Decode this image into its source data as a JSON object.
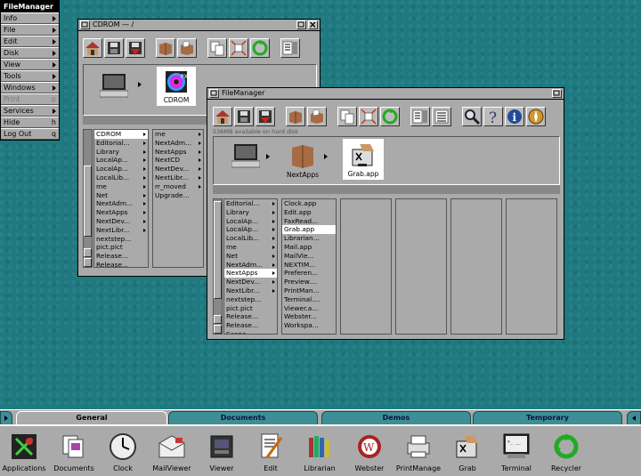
{
  "main_menu": {
    "title": "FileManager",
    "items": [
      {
        "label": "Info",
        "key": "arrow"
      },
      {
        "label": "File",
        "key": "arrow"
      },
      {
        "label": "Edit",
        "key": "arrow"
      },
      {
        "label": "Disk",
        "key": "arrow"
      },
      {
        "label": "View",
        "key": "arrow"
      },
      {
        "label": "Tools",
        "key": "arrow"
      },
      {
        "label": "Windows",
        "key": "arrow"
      },
      {
        "label": "Print",
        "key": "p",
        "disabled": true
      },
      {
        "label": "Services",
        "key": "arrow"
      },
      {
        "label": "Hide",
        "key": "h"
      },
      {
        "label": "Log Out",
        "key": "q"
      }
    ]
  },
  "cdrom_window": {
    "title": "CDROM — /",
    "shelf": {
      "cdrom_label": "CDROM"
    },
    "col1": [
      {
        "t": "CDROM",
        "a": true,
        "sel": true
      },
      {
        "t": "Editorial...",
        "a": true
      },
      {
        "t": "Library",
        "a": true
      },
      {
        "t": "LocalAp...",
        "a": true
      },
      {
        "t": "LocalAp...",
        "a": true
      },
      {
        "t": "LocalLib...",
        "a": true
      },
      {
        "t": "me",
        "a": true
      },
      {
        "t": "Net",
        "a": true
      },
      {
        "t": "NextAdm...",
        "a": true
      },
      {
        "t": "NextApps",
        "a": true
      },
      {
        "t": "NextDev...",
        "a": true
      },
      {
        "t": "NextLibr...",
        "a": true
      },
      {
        "t": "nextstep...",
        "a": false
      },
      {
        "t": "pict.pict",
        "a": false
      },
      {
        "t": "Release...",
        "a": false
      },
      {
        "t": "Release...",
        "a": false
      }
    ],
    "col2": [
      {
        "t": "me",
        "a": true
      },
      {
        "t": "NextAdm...",
        "a": true
      },
      {
        "t": "NextApps",
        "a": true
      },
      {
        "t": "NextCD",
        "a": true
      },
      {
        "t": "NextDev...",
        "a": true
      },
      {
        "t": "NextLibr...",
        "a": true
      },
      {
        "t": "rr_moved",
        "a": true
      },
      {
        "t": "Upgrade...",
        "a": false
      }
    ]
  },
  "fm_window": {
    "title": "FileManager",
    "status": "536MB available on hard disk",
    "shelf": {
      "nextapps_label": "NextApps",
      "grab_label": "Grab.app"
    },
    "col1": [
      {
        "t": "Editorial...",
        "a": true
      },
      {
        "t": "Library",
        "a": true
      },
      {
        "t": "LocalAp...",
        "a": true
      },
      {
        "t": "LocalAp...",
        "a": true
      },
      {
        "t": "LocalLib...",
        "a": true
      },
      {
        "t": "me",
        "a": true
      },
      {
        "t": "Net",
        "a": true
      },
      {
        "t": "NextAdm...",
        "a": true
      },
      {
        "t": "NextApps",
        "a": true,
        "sel": true
      },
      {
        "t": "NextDev...",
        "a": true
      },
      {
        "t": "NextLibr...",
        "a": true
      },
      {
        "t": "nextstep...",
        "a": false
      },
      {
        "t": "pict.pict",
        "a": false
      },
      {
        "t": "Release...",
        "a": false
      },
      {
        "t": "Release...",
        "a": false
      },
      {
        "t": "Scene_...",
        "a": false
      }
    ],
    "col2": [
      {
        "t": "Clock.app"
      },
      {
        "t": "Edit.app"
      },
      {
        "t": "FaxRead..."
      },
      {
        "t": "Grab.app",
        "sel": true
      },
      {
        "t": "Librarian..."
      },
      {
        "t": "Mail.app"
      },
      {
        "t": "MailVie..."
      },
      {
        "t": "NEXTIM..."
      },
      {
        "t": "Preferen..."
      },
      {
        "t": "Preview...."
      },
      {
        "t": "PrintMan..."
      },
      {
        "t": "Terminal...."
      },
      {
        "t": "Viewer.a..."
      },
      {
        "t": "Webster..."
      },
      {
        "t": "Workspa..."
      }
    ]
  },
  "dock": {
    "tabs": [
      {
        "label": "General",
        "active": true
      },
      {
        "label": "Documents"
      },
      {
        "label": "Demos"
      },
      {
        "label": "Temporary"
      }
    ],
    "items": [
      {
        "label": "Applications",
        "icon": "applications-icon"
      },
      {
        "label": "Documents",
        "icon": "documents-icon"
      },
      {
        "label": "Clock",
        "icon": "clock-icon"
      },
      {
        "label": "MailViewer",
        "icon": "mail-icon"
      },
      {
        "label": "Viewer",
        "icon": "viewer-icon"
      },
      {
        "label": "Edit",
        "icon": "edit-icon"
      },
      {
        "label": "Librarian",
        "icon": "librarian-icon"
      },
      {
        "label": "Webster",
        "icon": "webster-icon"
      },
      {
        "label": "PrintManage",
        "icon": "printer-icon"
      },
      {
        "label": "Grab",
        "icon": "grab-icon"
      },
      {
        "label": "Terminal",
        "icon": "terminal-icon"
      },
      {
        "label": "Recycler",
        "icon": "recycler-icon"
      }
    ]
  },
  "colors": {
    "desktop": "#1e7a80",
    "chrome": "#aaaaaa",
    "recycle_green": "#22aa22"
  }
}
